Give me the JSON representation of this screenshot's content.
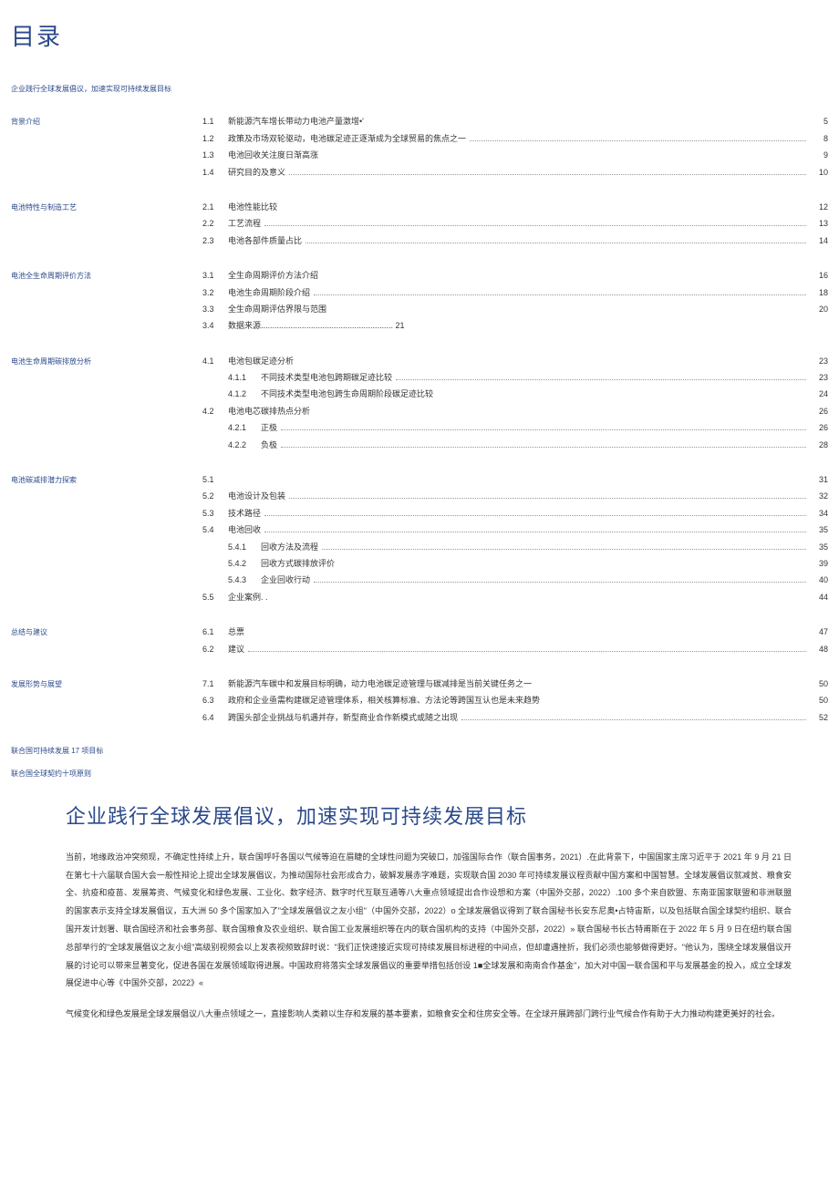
{
  "title": "目录",
  "subtitle": "企业践行全球发展倡议，加速实现可持续发展目标",
  "sections": [
    {
      "heading": "背景介绍",
      "items": [
        {
          "num": "1.1",
          "text": "新能源汽车增长带动力电池产量激增•'",
          "page": "5",
          "dots": false,
          "sub": false
        },
        {
          "num": "1.2",
          "text": "政策及市场双轮驱动，电池碳足迹正逐渐成为全球贸易的焦点之一",
          "page": "8",
          "dots": true,
          "sub": false
        },
        {
          "num": "1.3",
          "text": "电池回收关注度日渐高涨",
          "page": "9",
          "dots": false,
          "sub": false
        },
        {
          "num": "1.4",
          "text": "研究目的及意义",
          "page": "10",
          "dots": true,
          "sub": false
        }
      ]
    },
    {
      "heading": "电池特性与制造工艺",
      "items": [
        {
          "num": "2.1",
          "text": "电池性能比较",
          "page": "12",
          "dots": false,
          "sub": false
        },
        {
          "num": "2.2",
          "text": "工艺流程",
          "page": "13",
          "dots": true,
          "sub": false
        },
        {
          "num": "2.3",
          "text": "电池各部件质量占比",
          "page": "14",
          "dots": true,
          "sub": false
        }
      ]
    },
    {
      "heading": "电池全生命周期评价方法",
      "items": [
        {
          "num": "3.1",
          "text": "全生命周期评价方法介绍",
          "page": "16",
          "dots": false,
          "sub": false
        },
        {
          "num": "3.2",
          "text": "电池生命周期阶段介绍",
          "page": "18",
          "dots": true,
          "sub": false
        },
        {
          "num": "3.3",
          "text": "全生命周期评估界限与范围",
          "page": "20",
          "dots": false,
          "sub": false
        },
        {
          "num": "3.4",
          "text": "数据来源.......................................................... 21",
          "page": "",
          "dots": false,
          "sub": false
        }
      ]
    },
    {
      "heading": "电池生命周期碳排放分析",
      "items": [
        {
          "num": "4.1",
          "text": "电池包碳足迹分析",
          "page": "23",
          "dots": false,
          "sub": false
        },
        {
          "num": "4.1.1",
          "text": "不同技术类型电池包跨期碳足迹比较",
          "page": "23",
          "dots": true,
          "sub": true
        },
        {
          "num": "4.1.2",
          "text": "不同技术类型电池包跨生命周期阶段碳足迹比较",
          "page": "24",
          "dots": false,
          "sub": true
        },
        {
          "num": "4.2",
          "text": "电池电芯碳排热点分析",
          "page": "26",
          "dots": false,
          "sub": false
        },
        {
          "num": "4.2.1",
          "text": "正极",
          "page": "26",
          "dots": true,
          "sub": true
        },
        {
          "num": "4.2.2",
          "text": "负极",
          "page": "28",
          "dots": true,
          "sub": true
        }
      ]
    },
    {
      "heading": "电池碳减排潜力探索",
      "items": [
        {
          "num": "5.1",
          "text": "",
          "page": "31",
          "dots": false,
          "sub": false
        },
        {
          "num": "5.2",
          "text": "电池设计及包装",
          "page": "32",
          "dots": true,
          "sub": false
        },
        {
          "num": "5.3",
          "text": "技术路径",
          "page": "34",
          "dots": true,
          "sub": false
        },
        {
          "num": "5.4",
          "text": "电池回收",
          "page": "35",
          "dots": true,
          "sub": false
        },
        {
          "num": "5.4.1",
          "text": "回收方法及流程",
          "page": "35",
          "dots": true,
          "sub": true
        },
        {
          "num": "5.4.2",
          "text": "回收方式碳排放评价",
          "page": "39",
          "dots": false,
          "sub": true
        },
        {
          "num": "5.4.3",
          "text": "企业回收行动",
          "page": "40",
          "dots": true,
          "sub": true
        },
        {
          "num": "5.5",
          "text": "企业案例. .",
          "page": "44",
          "dots": false,
          "sub": false
        }
      ]
    },
    {
      "heading": "总结与建议",
      "items": [
        {
          "num": "6.1",
          "text": "总票",
          "page": "47",
          "dots": false,
          "sub": false
        },
        {
          "num": "6.2",
          "text": "建议",
          "page": "48",
          "dots": true,
          "sub": false
        }
      ]
    },
    {
      "heading": "发展形势与展望",
      "items": [
        {
          "num": "7.1",
          "text": "新能源汽车碳中和发展目标明确，动力电池碳足迹管理与碳减排是当前关键任务之一",
          "page": "50",
          "dots": false,
          "sub": false
        },
        {
          "num": "6.3",
          "text": "政府和企业亟需构建碳足迹管理体系，相关核算标准、方法论等跨国互认也是未来趋势",
          "page": "50",
          "dots": false,
          "sub": false
        },
        {
          "num": "6.4",
          "text": "跨国头部企业挑战与机遇并存，新型商业合作新模式或随之出现",
          "page": "52",
          "dots": true,
          "sub": false
        }
      ]
    }
  ],
  "appendix": [
    "联合国可持续发展 17 项目标",
    "联合国全球契约十项原则"
  ],
  "article": {
    "title": "企业践行全球发展倡议，加速实现可持续发展目标",
    "p1": "当前，地缘政治冲突频现，不确定性持续上升，联合国呼吁各国以气候等迫在眉睫的全球性问题为突破口，加强国际合作（联合国事务，2021）.在此背景下，中国国家主席习近平于 2021 年 9 月 21 日在第七十六届联合国大会一般性辩论上提出全球发展倡议，为推动国际社会形成合力，破解发展赤字难题，实现联合国 2030 年可持续发展议程贡献中国方案和中国智慧。全球发展倡议就减贫、粮食安全、抗疫和疫苗、发展筹资、气候变化和绿色发展、工业化、数字经济、数字时代互联互通等八大重点领域提出合作设想和方案（中国外交部，2022）.100 多个来自欧盟、东南亚国家联盟和非洲联盟的国家表示支持全球发展倡议，五大洲 50 多个国家加入了\"全球发展倡议之友小组\"（中国外交部，2022）o 全球发展倡议得到了联合国秘书长安东尼奥•占特宙斯，以及包括联合国全球契约组织、联合国开发计划署、联合国经济和社会事务部、联合国粮食及农业组织、联合国工业发展组织等在内的联合国机构的支持（中国外交部，2022）» 联合国秘书长古特甫斯在于 2022 年 5 月 9 日在纽约联合国总部举行的\"全球发展倡议之友小组\"高级别视频会以上发表视频致辞时说：\"我们正快速接近实现可持续发展目标进程的中间点，但却遭遇挫折，我们必须也能够做得更好。\"他认为，围绕全球发展倡议开展的讨论可以带来显著变化，促进各国在发展领域取得进展。中国政府将落实全球发展倡议的重要举措包括创设 1■全球发展和南南合作基金\"，加大对中国一联合国和平与发展基金的投入，成立全球发展促进中心等《中国外交部，2022》«",
    "p2": "气候变化和绿色发展是全球发展倡议八大重点领域之一，直接影响人类赖以生存和发展的基本要素，如粮食安全和住房安全等。在全球开展跨部门跨行业气候合作有助于大力推动构建更美好的社会。"
  }
}
